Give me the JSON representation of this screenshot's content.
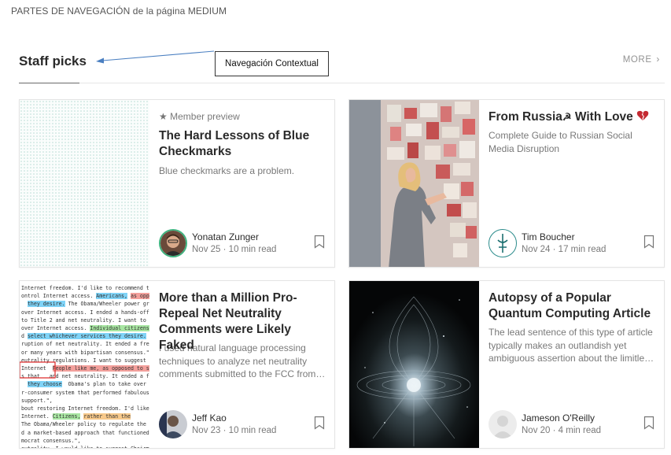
{
  "page_caption": "PARTES DE NAVEGACIÓN de la página MEDIUM",
  "annotation": {
    "label": "Navegación Contextual"
  },
  "section": {
    "title": "Staff picks",
    "more_label": "MORE",
    "more_icon": "chevron-right-icon"
  },
  "cards": [
    {
      "badge_icon": "star-icon",
      "badge": "Member preview",
      "title": "The Hard Lessons of Blue Checkmarks",
      "subtitle": "Blue checkmarks are a problem.",
      "author": "Yonatan Zunger",
      "date": "Nov 25",
      "read_time": "10 min read",
      "image": "dotted-pattern"
    },
    {
      "title": "From Russia",
      "title_suffix": "With Love",
      "title_icons": [
        "hammer-sickle-icon",
        "broken-heart-icon"
      ],
      "subtitle": "Complete Guide to Russian Social Media Disruption",
      "author": "Tim Boucher",
      "date": "Nov 24",
      "read_time": "17 min read",
      "image": "woman-at-paper-wall"
    },
    {
      "title": "More than a Million Pro-Repeal Net Neutrality Comments were Likely Faked",
      "subtitle": "I used natural language processing techniques to analyze net neutrality comments submitted to the FCC from…",
      "author": "Jeff Kao",
      "date": "Nov 23",
      "read_time": "10 min read",
      "image": "highlighted-text"
    },
    {
      "title": "Autopsy of a Popular Quantum Computing Article",
      "subtitle": "The lead sentence of this type of article typically makes an outlandish yet ambiguous assertion about the limitle…",
      "author": "Jameson O'Reilly",
      "date": "Nov 20",
      "read_time": "4 min read",
      "image": "quantum-cosmos"
    }
  ],
  "image_text_lines": [
    "Internet freedom. I'd like to recommend the",
    "ontrol Internet access. Americans, as opposed",
    "  they desire. The Obama/Wheeler power grab t",
    "over Internet access. I ended a hands-off policy that worke",
    "to Title 2 and net neutrality. I want to ar",
    "over Internet access. Individual citizens,",
    "d select whichever services they desire. Bec",
    "ruption of net neutrality. It ended a free-e",
    "or many years with bipartisan consensus.\",",
    "eutrality regulations. I want to suggest the",
    "Internet  People like me, as opposed to so",
    "s that   and net neutrality. It ended a fr",
    "  they choose  Obama's plan to take over the",
    "r-consumer system that performed fabulously",
    "support.\",",
    "bout restoring Internet freedom. I'd like to",
    "Internet. Citizens, rather than the",
    "The Obama/Wheeler policy to regulate the I",
    "d a market-based approach that functioned v",
    "mocrat consensus.\",",
    "eutrality. I would like to suggest Chairman",
    "tizens, as opposed to Washington bureaucrat",
    "  Obama's scheme to control the web is a bet",
    "that functioned very, very successfully fo"
  ]
}
